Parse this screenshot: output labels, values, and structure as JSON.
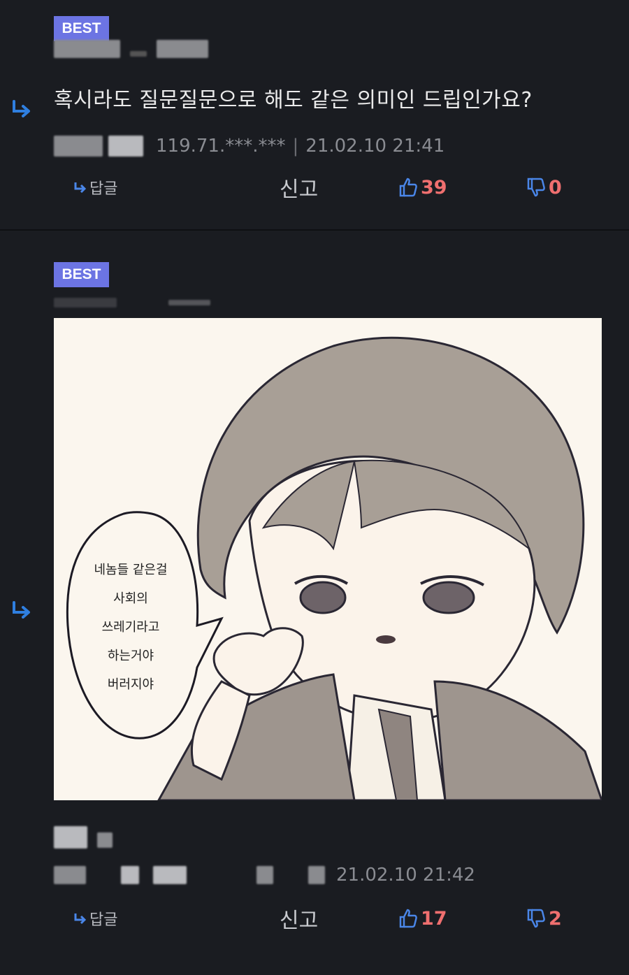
{
  "comments": [
    {
      "badge": "BEST",
      "text": "혹시라도 질문질문으로 해도 같은 의미인 드립인가요?",
      "ip": "119.71.***.***",
      "separator": "|",
      "timestamp": "21.02.10 21:41",
      "actions": {
        "reply_label": "답글",
        "report_label": "신고",
        "likes": "39",
        "dislikes": "0"
      }
    },
    {
      "badge": "BEST",
      "timestamp": "21.02.10 21:42",
      "image": {
        "bubble_lines": [
          "네놈들 같은걸",
          "사회의",
          "쓰레기라고",
          "하는거야",
          "버러지야"
        ]
      },
      "actions": {
        "reply_label": "답글",
        "report_label": "신고",
        "likes": "17",
        "dislikes": "2"
      }
    }
  ],
  "colors": {
    "background": "#1a1c21",
    "badge": "#6c74e3",
    "reply_arrow": "#2f7fe0",
    "vote_count": "#ef6f6f",
    "icon_blue": "#4a86e8"
  },
  "icons": {
    "reply_indent": "reply-arrow-icon",
    "reply_small": "reply-small-arrow-icon",
    "like": "thumbs-up-icon",
    "dislike": "thumbs-down-icon"
  }
}
